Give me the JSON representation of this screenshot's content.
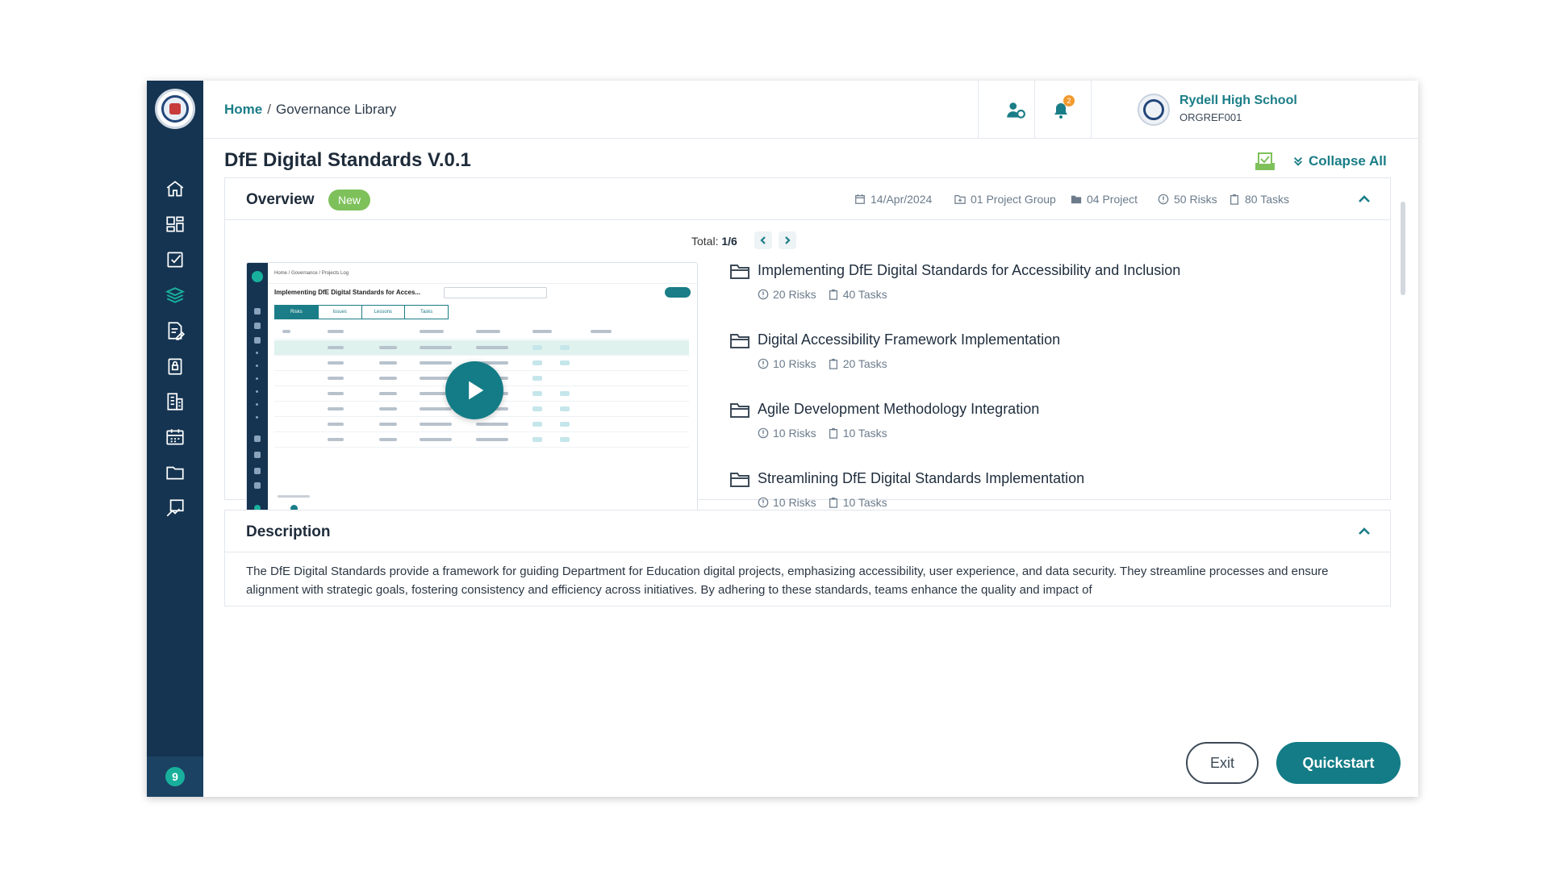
{
  "breadcrumb": {
    "home": "Home",
    "separator": "/",
    "current": "Governance Library"
  },
  "header": {
    "school_name": "Rydell High School",
    "school_ref": "ORGREF001",
    "notification_count": "2"
  },
  "page": {
    "title": "DfE Digital Standards V.0.1",
    "collapse_all": "Collapse All"
  },
  "overview": {
    "title": "Overview",
    "badge": "New",
    "meta": {
      "date": "14/Apr/2024",
      "project_group": "01 Project Group",
      "project": "04 Project",
      "risks": "50 Risks",
      "tasks": "80 Tasks"
    },
    "total_label": "Total:",
    "total_value": "1/6",
    "video_preview": {
      "breadcrumb": "Home / Governance / Projects Log",
      "title": "Implementing DfE Digital Standards for Acces...",
      "tabs": [
        "Risks",
        "Issues",
        "Lessons",
        "Tasks"
      ]
    },
    "projects": [
      {
        "title": "Implementing DfE Digital Standards for Accessibility and Inclusion",
        "risks": "20 Risks",
        "tasks": "40 Tasks"
      },
      {
        "title": "Digital Accessibility Framework Implementation",
        "risks": "10 Risks",
        "tasks": "20 Tasks"
      },
      {
        "title": "Agile Development Methodology Integration",
        "risks": "10 Risks",
        "tasks": "10 Tasks"
      },
      {
        "title": "Streamlining DfE Digital Standards Implementation",
        "risks": "10 Risks",
        "tasks": "10 Tasks"
      }
    ]
  },
  "description": {
    "title": "Description",
    "text": "The DfE Digital Standards provide a framework for guiding Department for Education digital projects, emphasizing accessibility, user experience, and data security. They streamline processes and ensure alignment with strategic goals, fostering consistency and efficiency across initiatives. By adhering to these standards, teams enhance the quality and impact of"
  },
  "footer": {
    "exit_label": "Exit",
    "quickstart_label": "Quickstart"
  },
  "sidebar": {
    "items": [
      "home-icon",
      "dashboard-icon",
      "checklist-icon",
      "library-icon",
      "edit-document-icon",
      "lock-icon",
      "building-icon",
      "calendar-icon",
      "folder-icon",
      "reports-icon"
    ],
    "bottom_badge": "9"
  },
  "colors": {
    "sidebar": "#153451",
    "accent": "#1a7d87",
    "new_badge": "#7ec15b",
    "primary_button": "#137c86"
  }
}
